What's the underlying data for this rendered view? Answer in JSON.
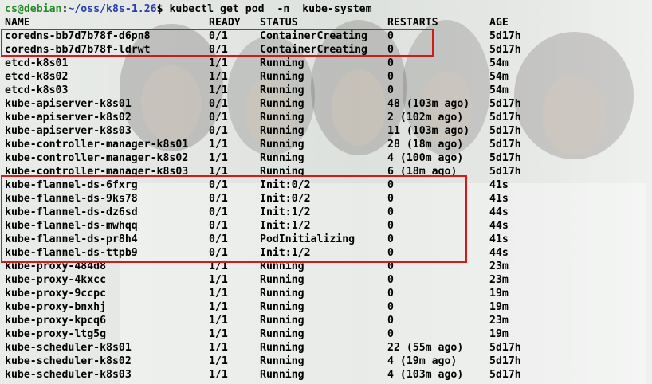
{
  "prompt": {
    "user_host": "cs@debian",
    "path": "~/oss/k8s-1.26",
    "symbol": "$",
    "command": "kubectl get pod  -n  kube-system"
  },
  "headers": [
    "NAME",
    "READY",
    "STATUS",
    "RESTARTS",
    "AGE"
  ],
  "rows": [
    {
      "name": "coredns-bb7d7b78f-d6pn8",
      "ready": "0/1",
      "status": "ContainerCreating",
      "restarts": "0",
      "age": "5d17h"
    },
    {
      "name": "coredns-bb7d7b78f-ldrwt",
      "ready": "0/1",
      "status": "ContainerCreating",
      "restarts": "0",
      "age": "5d17h"
    },
    {
      "name": "etcd-k8s01",
      "ready": "1/1",
      "status": "Running",
      "restarts": "0",
      "age": "54m"
    },
    {
      "name": "etcd-k8s02",
      "ready": "1/1",
      "status": "Running",
      "restarts": "0",
      "age": "54m"
    },
    {
      "name": "etcd-k8s03",
      "ready": "1/1",
      "status": "Running",
      "restarts": "0",
      "age": "54m"
    },
    {
      "name": "kube-apiserver-k8s01",
      "ready": "0/1",
      "status": "Running",
      "restarts": "48 (103m ago)",
      "age": "5d17h"
    },
    {
      "name": "kube-apiserver-k8s02",
      "ready": "0/1",
      "status": "Running",
      "restarts": "2 (102m ago)",
      "age": "5d17h"
    },
    {
      "name": "kube-apiserver-k8s03",
      "ready": "0/1",
      "status": "Running",
      "restarts": "11 (103m ago)",
      "age": "5d17h"
    },
    {
      "name": "kube-controller-manager-k8s01",
      "ready": "1/1",
      "status": "Running",
      "restarts": "28 (18m ago)",
      "age": "5d17h"
    },
    {
      "name": "kube-controller-manager-k8s02",
      "ready": "1/1",
      "status": "Running",
      "restarts": "4 (100m ago)",
      "age": "5d17h"
    },
    {
      "name": "kube-controller-manager-k8s03",
      "ready": "1/1",
      "status": "Running",
      "restarts": "6 (18m ago)",
      "age": "5d17h"
    },
    {
      "name": "kube-flannel-ds-6fxrg",
      "ready": "0/1",
      "status": "Init:0/2",
      "restarts": "0",
      "age": "41s"
    },
    {
      "name": "kube-flannel-ds-9ks78",
      "ready": "0/1",
      "status": "Init:0/2",
      "restarts": "0",
      "age": "41s"
    },
    {
      "name": "kube-flannel-ds-dz6sd",
      "ready": "0/1",
      "status": "Init:1/2",
      "restarts": "0",
      "age": "44s"
    },
    {
      "name": "kube-flannel-ds-mwhqq",
      "ready": "0/1",
      "status": "Init:1/2",
      "restarts": "0",
      "age": "44s"
    },
    {
      "name": "kube-flannel-ds-pr8h4",
      "ready": "0/1",
      "status": "PodInitializing",
      "restarts": "0",
      "age": "41s"
    },
    {
      "name": "kube-flannel-ds-ttpb9",
      "ready": "0/1",
      "status": "Init:1/2",
      "restarts": "0",
      "age": "44s"
    },
    {
      "name": "kube-proxy-484d8",
      "ready": "1/1",
      "status": "Running",
      "restarts": "0",
      "age": "23m"
    },
    {
      "name": "kube-proxy-4kxcc",
      "ready": "1/1",
      "status": "Running",
      "restarts": "0",
      "age": "23m"
    },
    {
      "name": "kube-proxy-9ccpc",
      "ready": "1/1",
      "status": "Running",
      "restarts": "0",
      "age": "19m"
    },
    {
      "name": "kube-proxy-bnxhj",
      "ready": "1/1",
      "status": "Running",
      "restarts": "0",
      "age": "19m"
    },
    {
      "name": "kube-proxy-kpcq6",
      "ready": "1/1",
      "status": "Running",
      "restarts": "0",
      "age": "23m"
    },
    {
      "name": "kube-proxy-ltg5g",
      "ready": "1/1",
      "status": "Running",
      "restarts": "0",
      "age": "19m"
    },
    {
      "name": "kube-scheduler-k8s01",
      "ready": "1/1",
      "status": "Running",
      "restarts": "22 (55m ago)",
      "age": "5d17h"
    },
    {
      "name": "kube-scheduler-k8s02",
      "ready": "1/1",
      "status": "Running",
      "restarts": "4 (19m ago)",
      "age": "5d17h"
    },
    {
      "name": "kube-scheduler-k8s03",
      "ready": "1/1",
      "status": "Running",
      "restarts": "4 (103m ago)",
      "age": "5d17h"
    }
  ],
  "colors": {
    "prompt_user": "#2a8a2a",
    "prompt_path": "#2a40b0",
    "highlight_border": "#d31a1a",
    "text": "#000000"
  }
}
